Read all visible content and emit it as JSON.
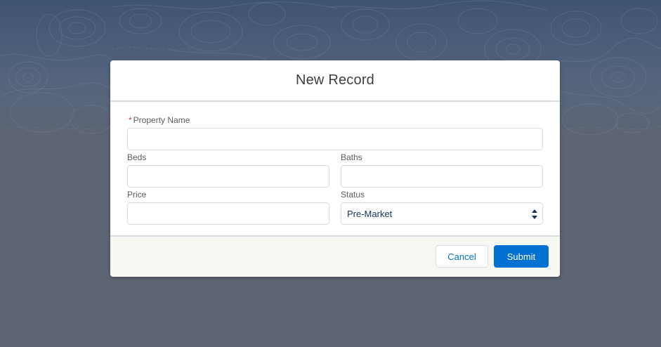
{
  "modal": {
    "title": "New Record"
  },
  "form": {
    "property_name": {
      "required_marker": "*",
      "label": "Property Name",
      "value": ""
    },
    "beds": {
      "label": "Beds",
      "value": ""
    },
    "baths": {
      "label": "Baths",
      "value": ""
    },
    "price": {
      "label": "Price",
      "value": ""
    },
    "status": {
      "label": "Status",
      "selected": "Pre-Market"
    }
  },
  "footer": {
    "cancel_label": "Cancel",
    "submit_label": "Submit"
  },
  "colors": {
    "brand": "#0070d2",
    "required": "#c23934",
    "backdrop": "#5e6573"
  }
}
